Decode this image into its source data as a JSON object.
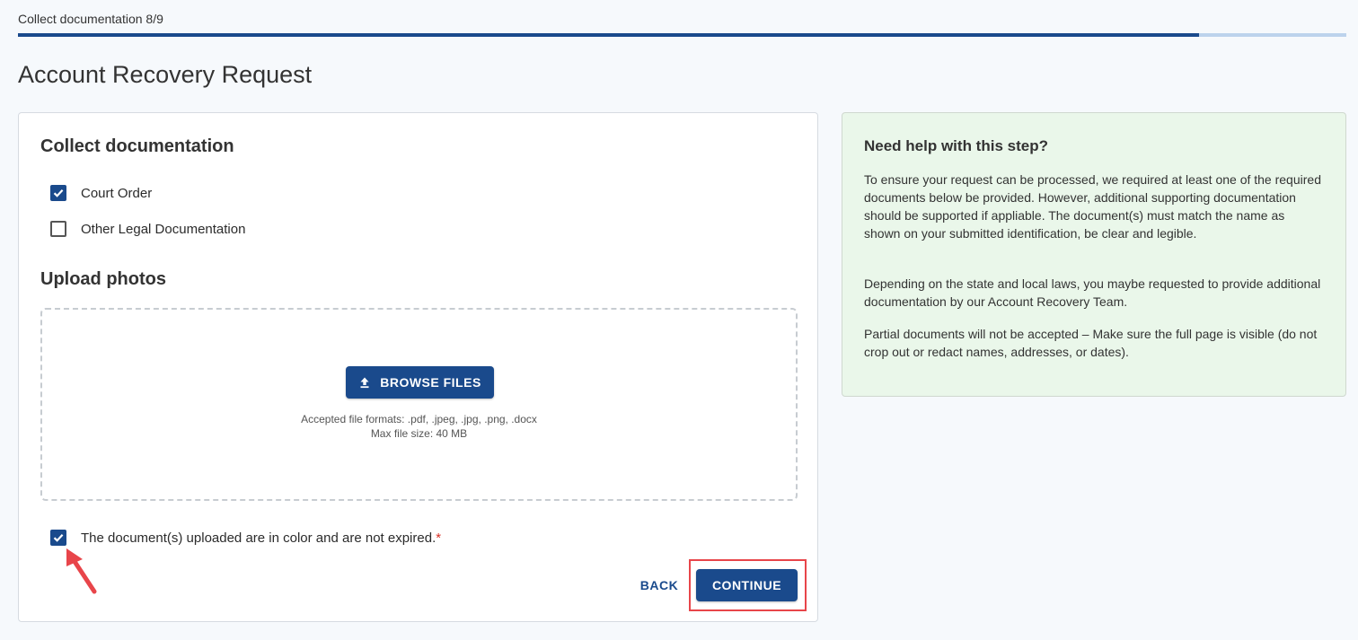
{
  "header": {
    "step_label": "Collect documentation 8/9",
    "progress_fraction": 0.8889,
    "page_title": "Account Recovery Request"
  },
  "main": {
    "section_title": "Collect documentation",
    "doc_options": [
      {
        "label": "Court Order",
        "checked": true
      },
      {
        "label": "Other Legal Documentation",
        "checked": false
      }
    ],
    "upload_title": "Upload photos",
    "browse_label": "BROWSE FILES",
    "formats_text": "Accepted file formats: .pdf, .jpeg, .jpg, .png, .docx",
    "max_size_text": "Max file size: 40 MB",
    "confirm_label": "The document(s) uploaded are in color and are not expired.",
    "required_mark": "*",
    "confirm_checked": true,
    "back_label": "BACK",
    "continue_label": "CONTINUE"
  },
  "help": {
    "title": "Need help with this step?",
    "paragraphs": [
      "To ensure your request can be processed, we required at least one of the required documents below be provided. However, additional supporting documentation should be supported if appliable. The document(s) must match the name as shown on your submitted identification, be clear and legible.",
      "Depending on the state and local laws, you maybe requested to provide additional documentation by our Account Recovery Team.",
      "Partial documents will not be accepted – Make sure the full page is visible (do not crop out or redact names, addresses, or dates)."
    ]
  },
  "colors": {
    "primary": "#1a4a8c",
    "progress_track": "#bcd3ec",
    "help_background": "#eaf7ea",
    "annotation_red": "#e8454a"
  },
  "icons": {
    "checked": "check-icon",
    "upload": "upload-icon",
    "annotation": "arrow-annotation-icon"
  }
}
